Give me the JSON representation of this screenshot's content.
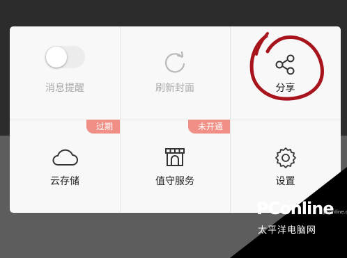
{
  "menu": {
    "items": [
      {
        "label": "消息提醒",
        "icon": "toggle-switch-icon",
        "state": "off",
        "disabled": true
      },
      {
        "label": "刷新封面",
        "icon": "refresh-icon",
        "disabled": true
      },
      {
        "label": "分享",
        "icon": "share-icon",
        "disabled": false
      },
      {
        "label": "云存储",
        "icon": "cloud-icon",
        "badge": "过期"
      },
      {
        "label": "值守服务",
        "icon": "store-icon",
        "badge": "未开通"
      },
      {
        "label": "设置",
        "icon": "gear-icon"
      }
    ]
  },
  "watermark": {
    "brand": "PConline",
    "url": "pconline.com.cn",
    "caption": "太平洋电脑网"
  },
  "colors": {
    "badge": "#f08f86",
    "panel": "#f8f8f8",
    "muted_text": "#a9a9a9",
    "annotation": "#a8141c"
  }
}
